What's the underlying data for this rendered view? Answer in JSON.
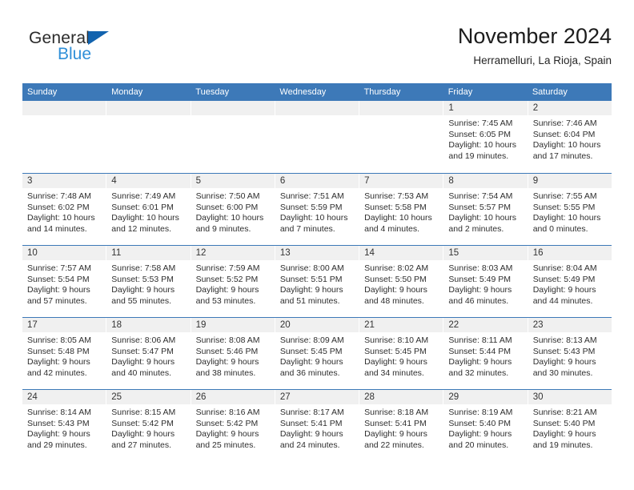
{
  "brand": {
    "name_top": "General",
    "name_bottom": "Blue",
    "triangle_color": "#1263ae",
    "blue_color": "#2f8fd8"
  },
  "header": {
    "title": "November 2024",
    "subtitle": "Herramelluri, La Rioja, Spain"
  },
  "calendar": {
    "accent_color": "#3d79b8",
    "daynum_band_color": "#f0f0f0",
    "weekday_headers": [
      "Sunday",
      "Monday",
      "Tuesday",
      "Wednesday",
      "Thursday",
      "Friday",
      "Saturday"
    ],
    "weeks": [
      [
        {
          "day": "",
          "sunrise": "",
          "sunset": "",
          "daylight": ""
        },
        {
          "day": "",
          "sunrise": "",
          "sunset": "",
          "daylight": ""
        },
        {
          "day": "",
          "sunrise": "",
          "sunset": "",
          "daylight": ""
        },
        {
          "day": "",
          "sunrise": "",
          "sunset": "",
          "daylight": ""
        },
        {
          "day": "",
          "sunrise": "",
          "sunset": "",
          "daylight": ""
        },
        {
          "day": "1",
          "sunrise": "Sunrise: 7:45 AM",
          "sunset": "Sunset: 6:05 PM",
          "daylight": "Daylight: 10 hours and 19 minutes."
        },
        {
          "day": "2",
          "sunrise": "Sunrise: 7:46 AM",
          "sunset": "Sunset: 6:04 PM",
          "daylight": "Daylight: 10 hours and 17 minutes."
        }
      ],
      [
        {
          "day": "3",
          "sunrise": "Sunrise: 7:48 AM",
          "sunset": "Sunset: 6:02 PM",
          "daylight": "Daylight: 10 hours and 14 minutes."
        },
        {
          "day": "4",
          "sunrise": "Sunrise: 7:49 AM",
          "sunset": "Sunset: 6:01 PM",
          "daylight": "Daylight: 10 hours and 12 minutes."
        },
        {
          "day": "5",
          "sunrise": "Sunrise: 7:50 AM",
          "sunset": "Sunset: 6:00 PM",
          "daylight": "Daylight: 10 hours and 9 minutes."
        },
        {
          "day": "6",
          "sunrise": "Sunrise: 7:51 AM",
          "sunset": "Sunset: 5:59 PM",
          "daylight": "Daylight: 10 hours and 7 minutes."
        },
        {
          "day": "7",
          "sunrise": "Sunrise: 7:53 AM",
          "sunset": "Sunset: 5:58 PM",
          "daylight": "Daylight: 10 hours and 4 minutes."
        },
        {
          "day": "8",
          "sunrise": "Sunrise: 7:54 AM",
          "sunset": "Sunset: 5:57 PM",
          "daylight": "Daylight: 10 hours and 2 minutes."
        },
        {
          "day": "9",
          "sunrise": "Sunrise: 7:55 AM",
          "sunset": "Sunset: 5:55 PM",
          "daylight": "Daylight: 10 hours and 0 minutes."
        }
      ],
      [
        {
          "day": "10",
          "sunrise": "Sunrise: 7:57 AM",
          "sunset": "Sunset: 5:54 PM",
          "daylight": "Daylight: 9 hours and 57 minutes."
        },
        {
          "day": "11",
          "sunrise": "Sunrise: 7:58 AM",
          "sunset": "Sunset: 5:53 PM",
          "daylight": "Daylight: 9 hours and 55 minutes."
        },
        {
          "day": "12",
          "sunrise": "Sunrise: 7:59 AM",
          "sunset": "Sunset: 5:52 PM",
          "daylight": "Daylight: 9 hours and 53 minutes."
        },
        {
          "day": "13",
          "sunrise": "Sunrise: 8:00 AM",
          "sunset": "Sunset: 5:51 PM",
          "daylight": "Daylight: 9 hours and 51 minutes."
        },
        {
          "day": "14",
          "sunrise": "Sunrise: 8:02 AM",
          "sunset": "Sunset: 5:50 PM",
          "daylight": "Daylight: 9 hours and 48 minutes."
        },
        {
          "day": "15",
          "sunrise": "Sunrise: 8:03 AM",
          "sunset": "Sunset: 5:49 PM",
          "daylight": "Daylight: 9 hours and 46 minutes."
        },
        {
          "day": "16",
          "sunrise": "Sunrise: 8:04 AM",
          "sunset": "Sunset: 5:49 PM",
          "daylight": "Daylight: 9 hours and 44 minutes."
        }
      ],
      [
        {
          "day": "17",
          "sunrise": "Sunrise: 8:05 AM",
          "sunset": "Sunset: 5:48 PM",
          "daylight": "Daylight: 9 hours and 42 minutes."
        },
        {
          "day": "18",
          "sunrise": "Sunrise: 8:06 AM",
          "sunset": "Sunset: 5:47 PM",
          "daylight": "Daylight: 9 hours and 40 minutes."
        },
        {
          "day": "19",
          "sunrise": "Sunrise: 8:08 AM",
          "sunset": "Sunset: 5:46 PM",
          "daylight": "Daylight: 9 hours and 38 minutes."
        },
        {
          "day": "20",
          "sunrise": "Sunrise: 8:09 AM",
          "sunset": "Sunset: 5:45 PM",
          "daylight": "Daylight: 9 hours and 36 minutes."
        },
        {
          "day": "21",
          "sunrise": "Sunrise: 8:10 AM",
          "sunset": "Sunset: 5:45 PM",
          "daylight": "Daylight: 9 hours and 34 minutes."
        },
        {
          "day": "22",
          "sunrise": "Sunrise: 8:11 AM",
          "sunset": "Sunset: 5:44 PM",
          "daylight": "Daylight: 9 hours and 32 minutes."
        },
        {
          "day": "23",
          "sunrise": "Sunrise: 8:13 AM",
          "sunset": "Sunset: 5:43 PM",
          "daylight": "Daylight: 9 hours and 30 minutes."
        }
      ],
      [
        {
          "day": "24",
          "sunrise": "Sunrise: 8:14 AM",
          "sunset": "Sunset: 5:43 PM",
          "daylight": "Daylight: 9 hours and 29 minutes."
        },
        {
          "day": "25",
          "sunrise": "Sunrise: 8:15 AM",
          "sunset": "Sunset: 5:42 PM",
          "daylight": "Daylight: 9 hours and 27 minutes."
        },
        {
          "day": "26",
          "sunrise": "Sunrise: 8:16 AM",
          "sunset": "Sunset: 5:42 PM",
          "daylight": "Daylight: 9 hours and 25 minutes."
        },
        {
          "day": "27",
          "sunrise": "Sunrise: 8:17 AM",
          "sunset": "Sunset: 5:41 PM",
          "daylight": "Daylight: 9 hours and 24 minutes."
        },
        {
          "day": "28",
          "sunrise": "Sunrise: 8:18 AM",
          "sunset": "Sunset: 5:41 PM",
          "daylight": "Daylight: 9 hours and 22 minutes."
        },
        {
          "day": "29",
          "sunrise": "Sunrise: 8:19 AM",
          "sunset": "Sunset: 5:40 PM",
          "daylight": "Daylight: 9 hours and 20 minutes."
        },
        {
          "day": "30",
          "sunrise": "Sunrise: 8:21 AM",
          "sunset": "Sunset: 5:40 PM",
          "daylight": "Daylight: 9 hours and 19 minutes."
        }
      ]
    ]
  }
}
